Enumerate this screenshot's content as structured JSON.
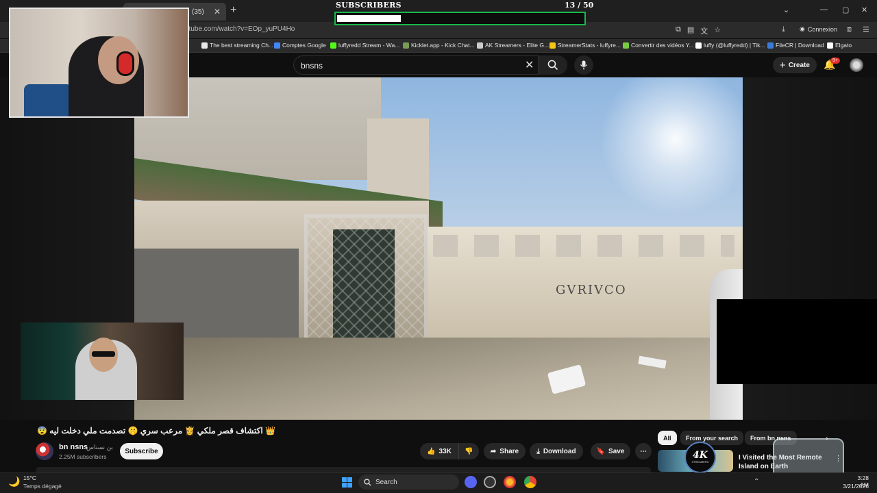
{
  "browser": {
    "tab_label": "(35)",
    "url": "utube.com/watch?v=EOp_yuPU4Ho",
    "connexion_label": "Connexion",
    "bookmarks": [
      {
        "label": "The best streaming Ch...",
        "color": "#e8e8e8"
      },
      {
        "label": "Comptes Google",
        "color": "#4285f4"
      },
      {
        "label": "luffyredd Stream - Wa...",
        "color": "#53fc18"
      },
      {
        "label": "Kicklet.app - Kick Chat...",
        "color": "#7a9a58"
      },
      {
        "label": "AK Streamers - Elite G...",
        "color": "#cccccc"
      },
      {
        "label": "StreamerStats - luffyre...",
        "color": "#f5c518"
      },
      {
        "label": "Convertir des vidéos Y...",
        "color": "#7ac943"
      },
      {
        "label": "luffy (@luffyredd) | Tik...",
        "color": "#ffffff"
      },
      {
        "label": "FileCR | Download",
        "color": "#3d7bd9"
      },
      {
        "label": "Elgato",
        "color": "#ffffff"
      }
    ]
  },
  "overlay": {
    "subscribers_label": "SUBSCRIBERS",
    "subscribers_count": "13 / 50",
    "progress_fraction": 0.26
  },
  "youtube": {
    "search_value": "bnsns",
    "create_label": "Create",
    "notification_badge": "9+",
    "video_graffiti": "GVRIVCO",
    "video_title": "😨 اكتشاف قصر ملكي 👸 مرعب سري 🤫 تصدمت ملي دخلت ليه 👑",
    "channel_name": "bn nsns",
    "channel_name_ar": "بن نسناس",
    "channel_subs": "2.25M subscribers",
    "subscribe_label": "Subscribe",
    "likes": "33K",
    "share_label": "Share",
    "download_label": "Download",
    "save_label": "Save",
    "chips": [
      "All",
      "From your search",
      "From bn nsns"
    ],
    "rec_title": "I Visited the Most Remote Island on Earth",
    "ak_logo_text": "4K",
    "ak_logo_sub": "STREAMERS"
  },
  "taskbar": {
    "temperature": "15°C",
    "weather": "Temps dégagé",
    "search_label": "Search",
    "time": "3:28 AM",
    "date": "3/21/2026"
  }
}
